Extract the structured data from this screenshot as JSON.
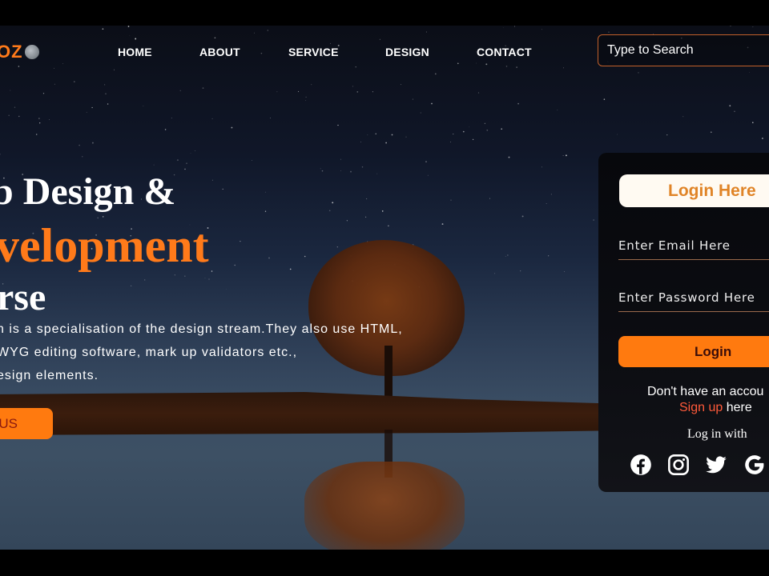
{
  "logo": {
    "text": "OZ"
  },
  "nav": {
    "items": [
      {
        "label": "HOME"
      },
      {
        "label": "ABOUT"
      },
      {
        "label": "SERVICE"
      },
      {
        "label": "DESIGN"
      },
      {
        "label": "CONTACT"
      }
    ]
  },
  "search": {
    "placeholder": "Type to Search"
  },
  "hero": {
    "line1": "b Design &",
    "line2": "velopment",
    "line3": "rse",
    "description": [
      "n is a specialisation of the design stream.They also use HTML,",
      "WYG editing software, mark up validators etc.,",
      "esign elements."
    ],
    "cta_label": "US"
  },
  "login": {
    "title": "Login Here",
    "email_placeholder": "Enter Email Here",
    "password_placeholder": "Enter Password Here",
    "button_label": "Login",
    "no_account_text": "Don't have an accou",
    "signup_link": "Sign up",
    "signup_suffix": " here",
    "login_with": "Log in with",
    "social": [
      "facebook",
      "instagram",
      "twitter",
      "google"
    ]
  },
  "colors": {
    "accent": "#ff7a1a",
    "signup": "#ff5a3a",
    "title_text": "#e08427"
  }
}
